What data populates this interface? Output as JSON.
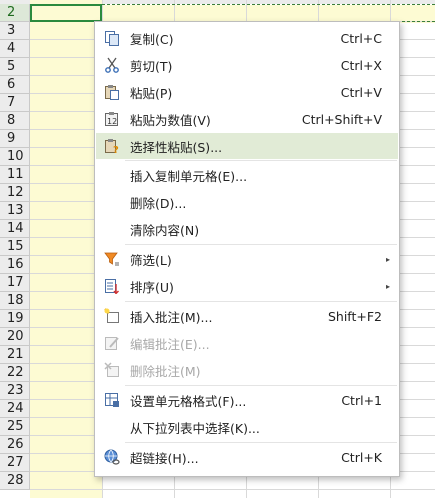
{
  "rows": [
    "2",
    "3",
    "4",
    "5",
    "6",
    "7",
    "8",
    "9",
    "10",
    "11",
    "12",
    "13",
    "14",
    "15",
    "16",
    "17",
    "18",
    "19",
    "20",
    "21",
    "22",
    "23",
    "24",
    "25",
    "26",
    "27",
    "28"
  ],
  "context_menu": {
    "items": [
      {
        "label": "复制(C)",
        "shortcut": "Ctrl+C",
        "icon": "copy-icon"
      },
      {
        "label": "剪切(T)",
        "shortcut": "Ctrl+X",
        "icon": "scissors-icon"
      },
      {
        "label": "粘贴(P)",
        "shortcut": "Ctrl+V",
        "icon": "paste-icon"
      },
      {
        "label": "粘贴为数值(V)",
        "shortcut": "Ctrl+Shift+V",
        "icon": "paste-values-icon"
      },
      {
        "label": "选择性粘贴(S)...",
        "shortcut": "",
        "icon": "paste-special-icon"
      },
      {
        "label": "插入复制单元格(E)...",
        "shortcut": ""
      },
      {
        "label": "删除(D)...",
        "shortcut": ""
      },
      {
        "label": "清除内容(N)",
        "shortcut": ""
      },
      {
        "label": "筛选(L)",
        "shortcut": "",
        "icon": "filter-icon"
      },
      {
        "label": "排序(U)",
        "shortcut": "",
        "icon": "sort-icon"
      },
      {
        "label": "插入批注(M)...",
        "shortcut": "Shift+F2",
        "icon": "insert-comment-icon"
      },
      {
        "label": "编辑批注(E)...",
        "shortcut": "",
        "icon": "edit-comment-icon"
      },
      {
        "label": "删除批注(M)",
        "shortcut": "",
        "icon": "delete-comment-icon"
      },
      {
        "label": "设置单元格格式(F)...",
        "shortcut": "Ctrl+1",
        "icon": "format-cells-icon"
      },
      {
        "label": "从下拉列表中选择(K)...",
        "shortcut": ""
      },
      {
        "label": "超链接(H)...",
        "shortcut": "Ctrl+K",
        "icon": "hyperlink-icon"
      }
    ],
    "submenu_arrow": "▸",
    "highlight_color": "#e1ebd6",
    "disabled_items": [
      "编辑批注(E)...",
      "删除批注(M)"
    ]
  }
}
